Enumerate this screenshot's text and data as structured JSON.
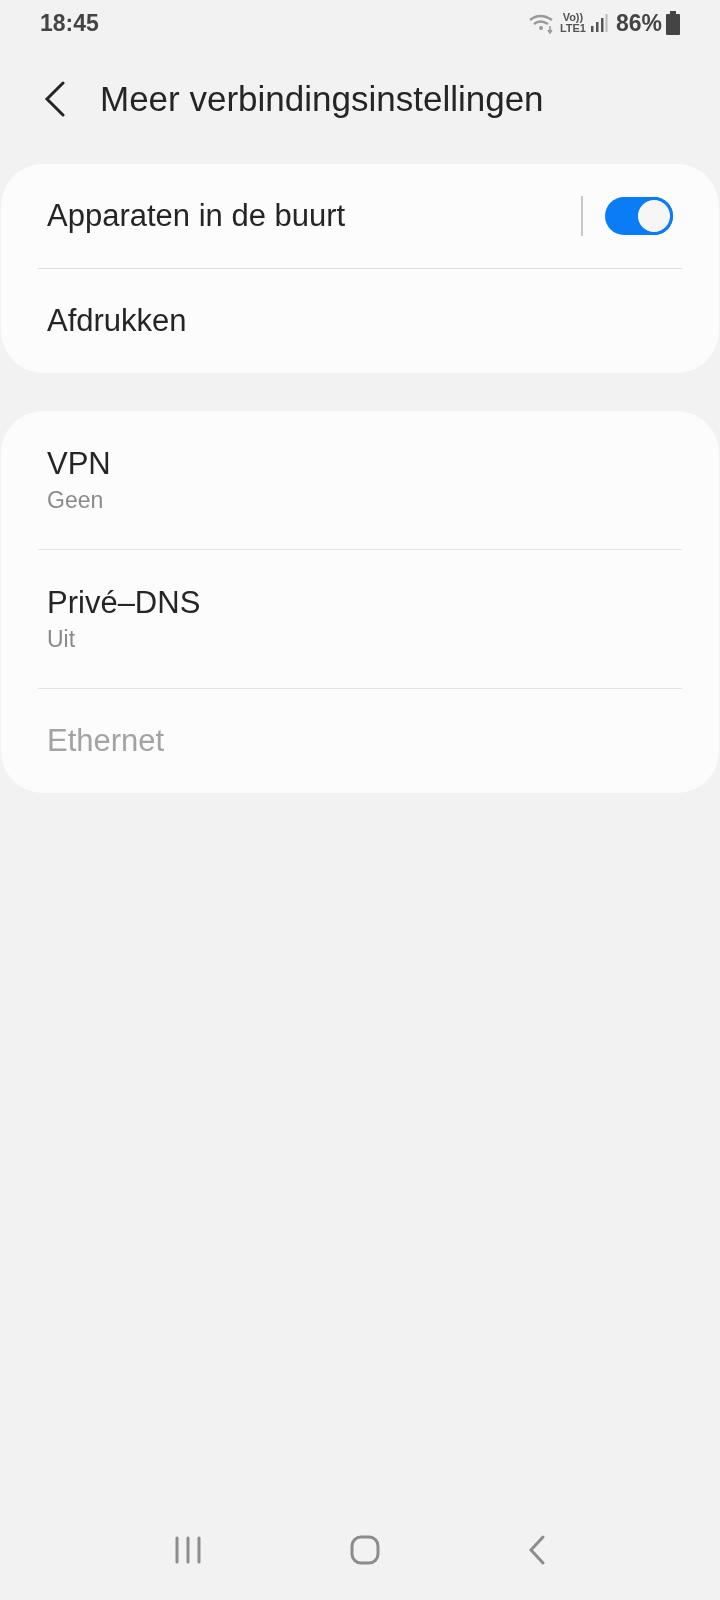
{
  "status_bar": {
    "time": "18:45",
    "volte": "Vo))",
    "network": "LTE1",
    "battery": "86%"
  },
  "header": {
    "title": "Meer verbindingsinstellingen"
  },
  "groups": [
    {
      "items": [
        {
          "kind": "toggle",
          "label": "Apparaten in de buurt",
          "on": true,
          "disabled": false
        },
        {
          "kind": "link",
          "label": "Afdrukken",
          "disabled": false
        }
      ]
    },
    {
      "items": [
        {
          "kind": "link",
          "label": "VPN",
          "summary": "Geen",
          "disabled": false
        },
        {
          "kind": "link",
          "label": "Privé–DNS",
          "summary": "Uit",
          "disabled": false
        },
        {
          "kind": "link",
          "label": "Ethernet",
          "disabled": true
        }
      ]
    }
  ]
}
